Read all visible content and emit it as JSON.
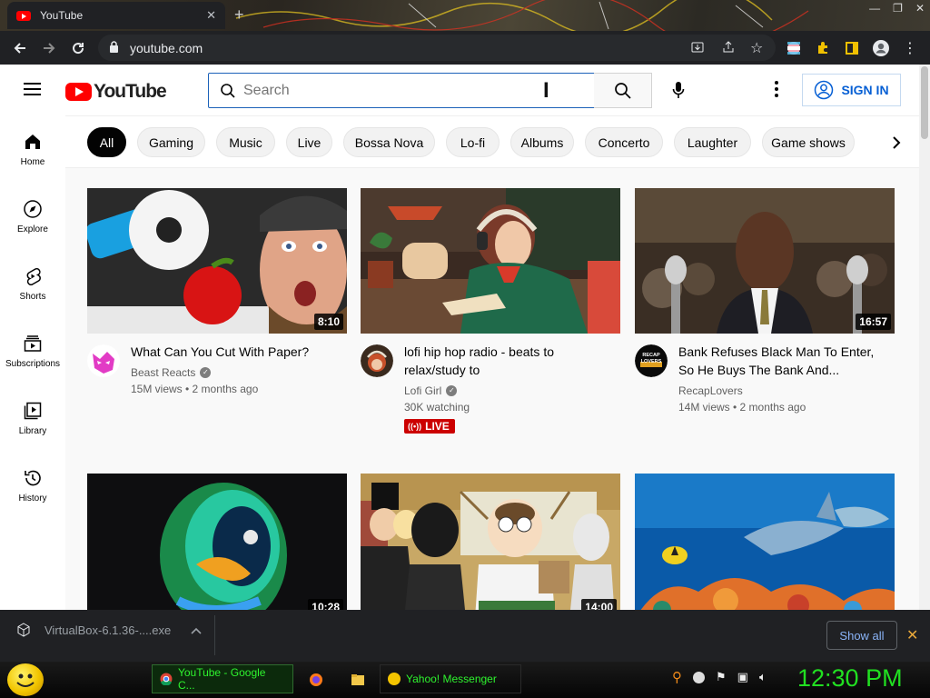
{
  "browser": {
    "tab_title": "YouTube",
    "url": "youtube.com"
  },
  "youtube": {
    "logo_text": "YouTube",
    "search_placeholder": "Search",
    "sign_in": "SIGN IN",
    "chips": [
      "All",
      "Gaming",
      "Music",
      "Live",
      "Bossa Nova",
      "Lo-fi",
      "Albums",
      "Concerto",
      "Laughter",
      "Game shows"
    ],
    "sidebar": [
      "Home",
      "Explore",
      "Shorts",
      "Subscriptions",
      "Library",
      "History"
    ],
    "videos": [
      {
        "title": "What Can You Cut With Paper?",
        "channel": "Beast Reacts",
        "stats": "15M views • 2 months ago",
        "duration": "8:10"
      },
      {
        "title": "lofi hip hop radio - beats to relax/study to",
        "channel": "Lofi Girl",
        "stats": "30K watching",
        "live": "LIVE"
      },
      {
        "title": "Bank Refuses Black Man To Enter, So He Buys The Bank And...",
        "channel": "RecapLovers",
        "stats": "14M views • 2 months ago",
        "duration": "16:57",
        "avatar_text": "RECAP LOVERS"
      },
      {
        "duration": "10:28"
      },
      {
        "duration": "14:00"
      },
      {}
    ]
  },
  "downloads": {
    "file": "VirtualBox-6.1.36-....exe",
    "show_all": "Show all"
  },
  "taskbar": {
    "tasks": [
      "YouTube - Google C...",
      "Yahoo! Messenger"
    ],
    "clock": "12:30 PM"
  },
  "colors": {
    "yt_red": "#ff0000",
    "link_blue": "#065fd4",
    "taskbar_green": "#21e021"
  }
}
